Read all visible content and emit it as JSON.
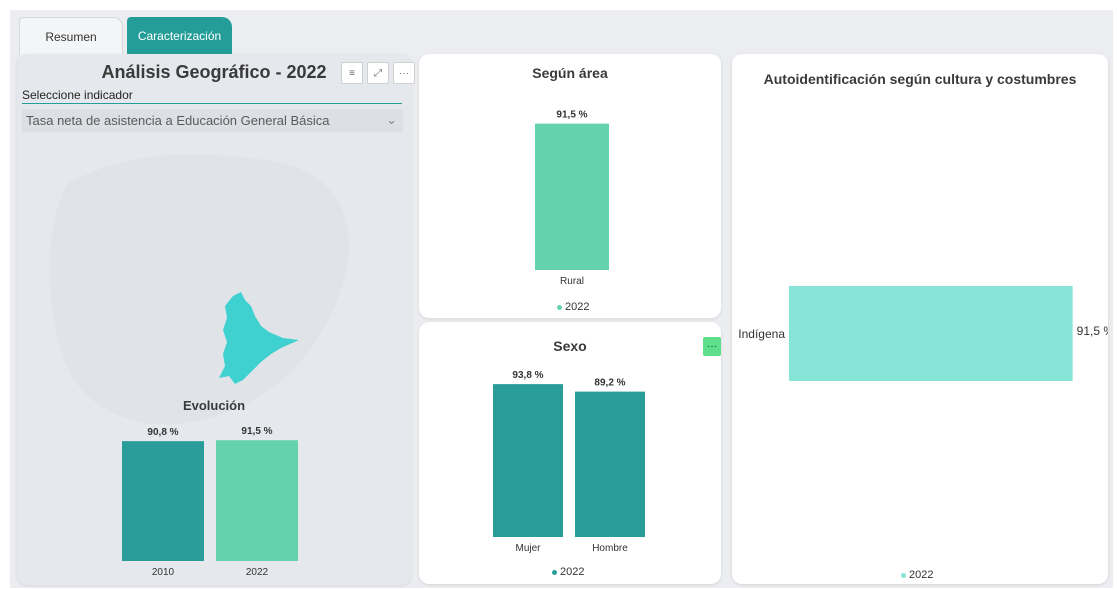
{
  "tabs": {
    "resumen": "Resumen",
    "caracterizacion": "Caracterización"
  },
  "geo": {
    "title": "Análisis Geográfico - 2022",
    "selector_label": "Seleccione indicador",
    "selector_value": "Tasa neta de asistencia a Educación General Básica"
  },
  "evolucion": {
    "title": "Evolución",
    "chart_data": {
      "type": "bar",
      "categories": [
        "2010",
        "2022"
      ],
      "values": [
        90.8,
        91.5
      ],
      "labels": [
        "90,8 %",
        "91,5 %"
      ],
      "title": "Evolución"
    }
  },
  "area": {
    "title": "Según área",
    "legend": "2022",
    "chart_data": {
      "type": "bar",
      "categories": [
        "Rural"
      ],
      "values": [
        91.5
      ],
      "labels": [
        "91,5 %"
      ],
      "series": [
        {
          "name": "2022",
          "values": [
            91.5
          ]
        }
      ]
    }
  },
  "sexo": {
    "title": "Sexo",
    "legend": "2022",
    "more": "···",
    "chart_data": {
      "type": "bar",
      "categories": [
        "Mujer",
        "Hombre"
      ],
      "values": [
        93.8,
        89.2
      ],
      "labels": [
        "93,8 %",
        "89,2 %"
      ],
      "series": [
        {
          "name": "2022",
          "values": [
            93.8,
            89.2
          ]
        }
      ]
    }
  },
  "auto": {
    "title": "Autoidentificación según cultura y costumbres",
    "legend": "2022",
    "chart_data": {
      "type": "bar",
      "orientation": "horizontal",
      "categories": [
        "Indígena"
      ],
      "values": [
        91.5
      ],
      "labels": [
        "91,5 %"
      ],
      "series": [
        {
          "name": "2022",
          "values": [
            91.5
          ]
        }
      ]
    }
  },
  "colors": {
    "dark_teal": "#2a9d9b",
    "mint": "#64d3ad",
    "light_teal": "#87e5d8",
    "accent": "#249d98",
    "map_fill": "#3ed1cf"
  }
}
